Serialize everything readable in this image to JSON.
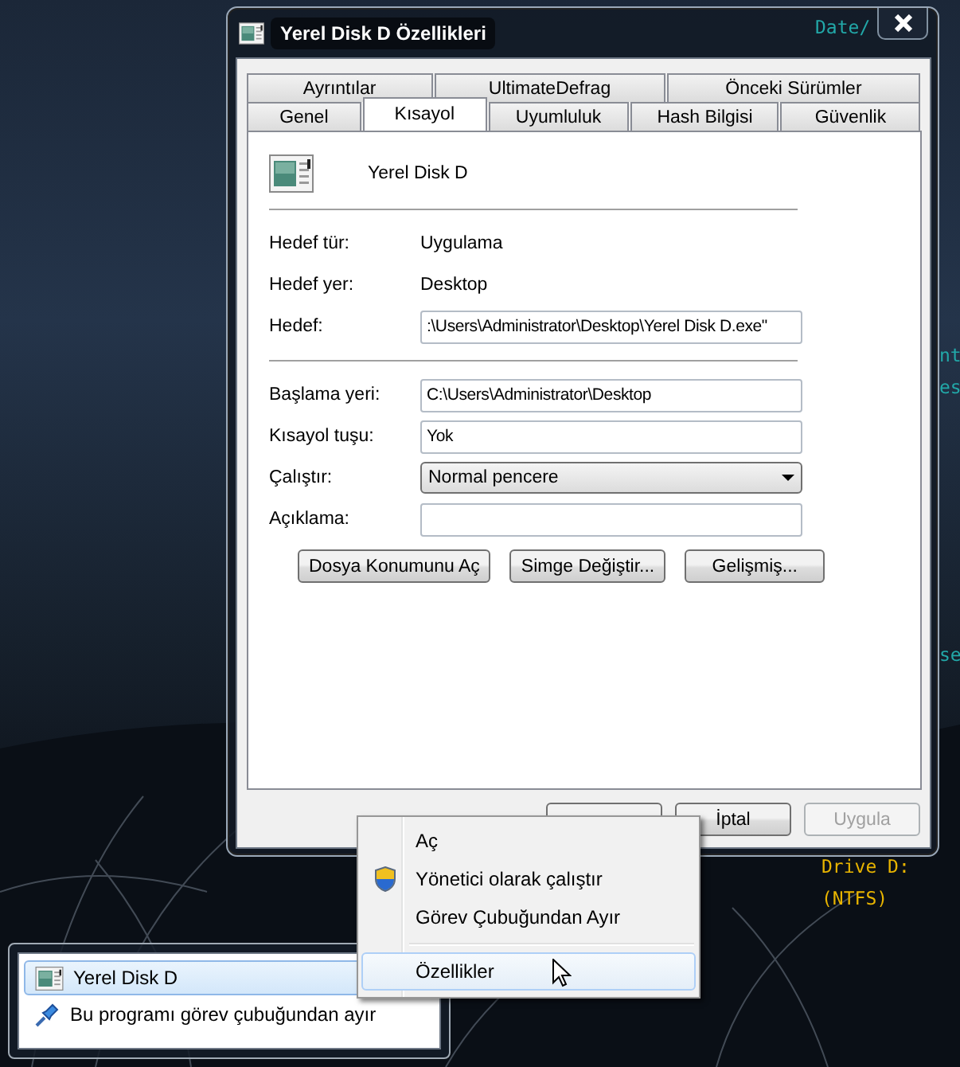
{
  "desktop": {
    "labels": [
      {
        "text": "Date/",
        "kind": "clock"
      },
      {
        "text": "nt",
        "kind": "fragment"
      },
      {
        "text": "es",
        "kind": "fragment"
      },
      {
        "text": "se",
        "kind": "fragment"
      },
      {
        "text": "Drive D:",
        "kind": "drive"
      },
      {
        "text": "(NTFS)",
        "kind": "drive"
      }
    ]
  },
  "dialog": {
    "title": "Yerel Disk D Özellikleri",
    "tab_rows": [
      [
        {
          "label": "Ayrıntılar",
          "selected": false
        },
        {
          "label": "UltimateDefrag",
          "selected": false
        },
        {
          "label": "Önceki Sürümler",
          "selected": false
        }
      ],
      [
        {
          "label": "Genel",
          "selected": false
        },
        {
          "label": "Kısayol",
          "selected": true
        },
        {
          "label": "Uyumluluk",
          "selected": false
        },
        {
          "label": "Hash Bilgisi",
          "selected": false
        },
        {
          "label": "Güvenlik",
          "selected": false
        }
      ]
    ],
    "header": {
      "name": "Yerel Disk D"
    },
    "sections": [
      [
        {
          "kind": "info",
          "label": "Hedef tür:",
          "value": "Uygulama"
        },
        {
          "kind": "info",
          "label": "Hedef yer:",
          "value": "Desktop"
        },
        {
          "kind": "input",
          "label": "Hedef:",
          "value": ":\\Users\\Administrator\\Desktop\\Yerel Disk D.exe\""
        }
      ],
      [
        {
          "kind": "input",
          "label": "Başlama yeri:",
          "value": "C:\\Users\\Administrator\\Desktop"
        },
        {
          "kind": "input",
          "label": "Kısayol tuşu:",
          "value": "Yok"
        },
        {
          "kind": "select",
          "label": "Çalıştır:",
          "value": "Normal pencere"
        },
        {
          "kind": "input",
          "label": "Açıklama:"
        }
      ]
    ],
    "actions": [
      "Dosya Konumunu Aç",
      "Simge Değiştir...",
      "Gelişmiş..."
    ],
    "footer_buttons": [
      {
        "disabled": false
      },
      {
        "label": "İptal",
        "disabled": false
      },
      {
        "label": "Uygula",
        "disabled": true
      }
    ]
  },
  "context_menu": {
    "items": [
      {
        "kind": "plain",
        "label": "Aç",
        "selected": false
      },
      {
        "kind": "elevated",
        "label": "Yönetici olarak çalıştır",
        "selected": false
      },
      {
        "kind": "plain",
        "label": "Görev Çubuğundan Ayır",
        "selected": false
      },
      {
        "kind": "separator"
      },
      {
        "kind": "plain",
        "label": "Özellikler",
        "selected": true
      }
    ]
  },
  "jump_list": {
    "items": [
      {
        "label": "Yerel Disk D",
        "kind": "program",
        "selected": true
      },
      {
        "label": "Bu programı görev çubuğundan ayır",
        "kind": "unpin",
        "selected": false
      }
    ]
  }
}
